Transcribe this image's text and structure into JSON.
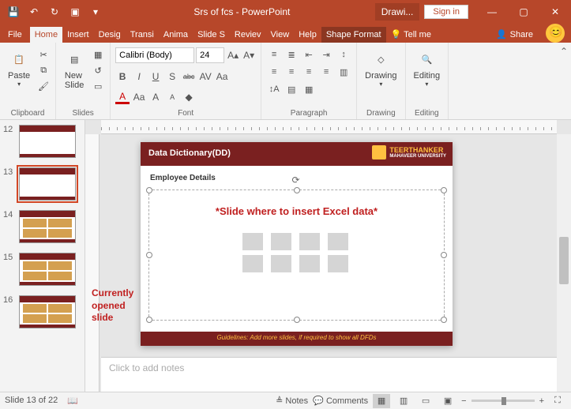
{
  "titlebar": {
    "title": "Srs of fcs - PowerPoint",
    "drawing": "Drawi...",
    "signin": "Sign in"
  },
  "tabs": {
    "file": "File",
    "home": "Home",
    "insert": "Insert",
    "design": "Desig",
    "transitions": "Transi",
    "animations": "Anima",
    "slideshow": "Slide S",
    "review": "Reviev",
    "view": "View",
    "help": "Help",
    "shape_format": "Shape Format",
    "tellme": "Tell me",
    "share": "Share"
  },
  "ribbon": {
    "clipboard": {
      "label": "Clipboard",
      "paste": "Paste"
    },
    "slides": {
      "label": "Slides",
      "new_slide": "New\nSlide"
    },
    "font": {
      "label": "Font",
      "name": "Calibri (Body)",
      "size": "24",
      "bold": "B",
      "italic": "I",
      "underline": "U",
      "strike": "S",
      "shadow": "abc",
      "spacing": "AV",
      "case": "Aa",
      "grow": "A",
      "shrink": "A",
      "clear": "Aρ"
    },
    "paragraph": {
      "label": "Paragraph"
    },
    "drawing": {
      "label": "Drawing",
      "btn": "Drawing"
    },
    "editing": {
      "label": "Editing",
      "btn": "Editing"
    }
  },
  "thumbnails": {
    "nums": [
      "12",
      "13",
      "14",
      "15",
      "16"
    ],
    "annotation": "Currently\nopened\nslide"
  },
  "slide": {
    "title": "Data Dictionary(DD)",
    "uni_name": "TEERTHANKER",
    "uni_sub": "MAHAVEER UNIVERSITY",
    "subtitle": "Employee Details",
    "annotation": "*Slide where to insert Excel data*",
    "footer": "Guidelines: Add more slides, if required to show all DFDs"
  },
  "notes": {
    "placeholder": "Click to add notes"
  },
  "statusbar": {
    "slidenum": "Slide 13 of 22",
    "lang": "",
    "notes": "Notes",
    "comments": "Comments",
    "zoom_minus": "−",
    "zoom_plus": "+"
  }
}
